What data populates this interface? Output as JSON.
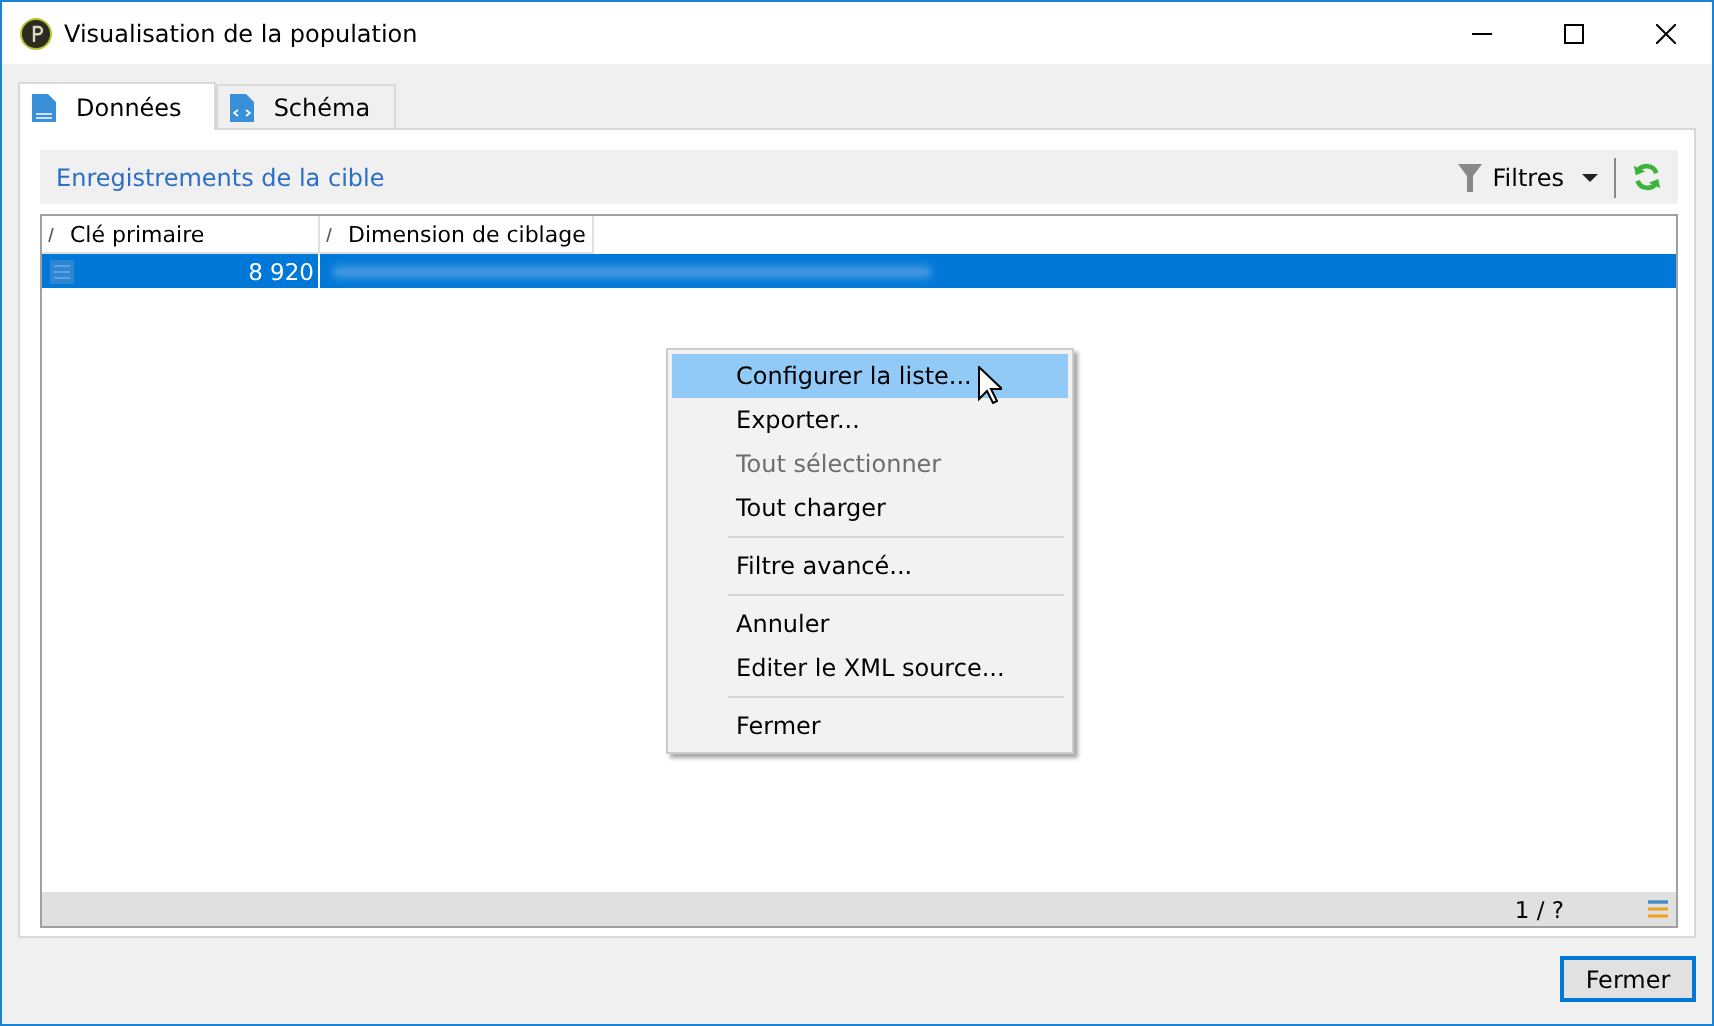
{
  "window": {
    "title": "Visualisation de la population"
  },
  "tabs": [
    {
      "label": "Données",
      "selected": true
    },
    {
      "label": "Schéma",
      "selected": false
    }
  ],
  "toolbar": {
    "title": "Enregistrements de la cible",
    "filter_label": "Filtres"
  },
  "table": {
    "columns": [
      "Clé primaire",
      "Dimension de ciblage"
    ],
    "rows": [
      {
        "cells": [
          "8 920"
        ],
        "selected": true
      }
    ]
  },
  "context_menu": [
    {
      "kind": "item",
      "label": "Configurer la liste...",
      "selected": true,
      "disabled": false
    },
    {
      "kind": "item",
      "label": "Exporter...",
      "selected": false,
      "disabled": false
    },
    {
      "kind": "item",
      "label": "Tout sélectionner",
      "selected": false,
      "disabled": true
    },
    {
      "kind": "item",
      "label": "Tout charger",
      "selected": false,
      "disabled": false
    },
    {
      "kind": "separator"
    },
    {
      "kind": "item",
      "label": "Filtre avancé...",
      "selected": false,
      "disabled": false
    },
    {
      "kind": "separator"
    },
    {
      "kind": "item",
      "label": "Annuler",
      "selected": false,
      "disabled": false
    },
    {
      "kind": "item",
      "label": "Editer le XML source...",
      "selected": false,
      "disabled": false
    },
    {
      "kind": "separator"
    },
    {
      "kind": "item",
      "label": "Fermer",
      "selected": false,
      "disabled": false
    }
  ],
  "status_bar": {
    "count": "1 / ?"
  },
  "buttons": [
    {
      "label": "Fermer"
    }
  ]
}
